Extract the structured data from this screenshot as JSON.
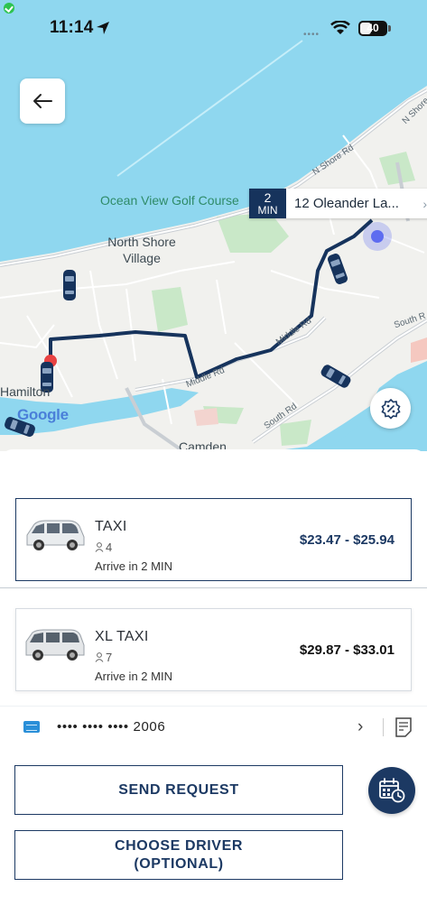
{
  "status_bar": {
    "time": "11:14",
    "battery": "40",
    "icons": [
      "location-arrow-icon",
      "wifi-icon",
      "battery-icon"
    ]
  },
  "map": {
    "labels": {
      "golf_course": "Ocean View Golf Course",
      "village": "North Shore Village",
      "hamilton": "Hamilton",
      "camden": "Camden",
      "road_n_shore_1": "N Shore Rd",
      "road_n_shore_2": "N Shore Rd",
      "road_middle_1": "Middle Rd",
      "road_middle_2": "Middle Rd",
      "road_south_1": "South Rd",
      "road_south_2": "South R"
    },
    "eta": {
      "minutes": "2",
      "unit": "MIN",
      "address": "12 Oleander La..."
    },
    "google": "Google"
  },
  "rides": [
    {
      "name": "TAXI",
      "seats": "4",
      "arrive": "Arrive in 2 MIN",
      "price": "$23.47 - $25.94",
      "selected": true
    },
    {
      "name": "XL TAXI",
      "seats": "7",
      "arrive": "Arrive in 2 MIN",
      "price": "$29.87 - $33.01",
      "selected": false
    }
  ],
  "payment": {
    "card_number": "•••• •••• •••• 2006"
  },
  "actions": {
    "send_request": "SEND REQUEST",
    "choose_driver_line1": "CHOOSE DRIVER",
    "choose_driver_line2": "(OPTIONAL)"
  },
  "colors": {
    "primary": "#1c3963",
    "route": "#16335c",
    "water": "#8fd7ef",
    "land": "#f1f1ee",
    "park": "#c9e8c8",
    "location_dot": "#5e6cf0"
  }
}
